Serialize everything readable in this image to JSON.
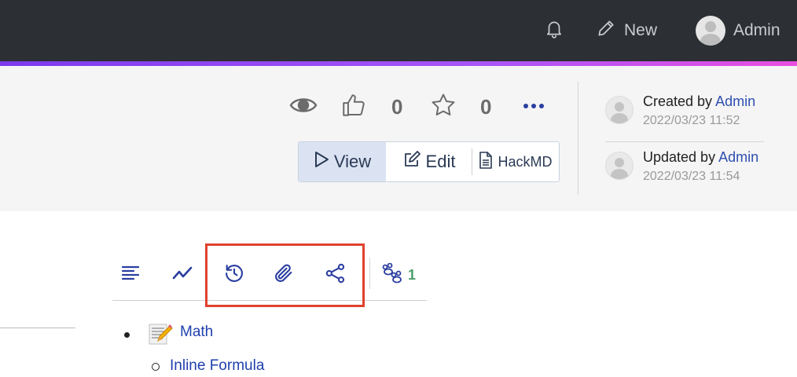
{
  "navbar": {
    "bell_icon": "bell-icon",
    "new_label": "New",
    "user_label": "Admin"
  },
  "page_header": {
    "seen_icon": "eye-icon",
    "like_count": "0",
    "star_count": "0",
    "buttons": {
      "view": "View",
      "edit": "Edit",
      "hackmd": "HackMD"
    },
    "created": {
      "prefix": "Created by",
      "user": "Admin",
      "time": "2022/03/23 11:52"
    },
    "updated": {
      "prefix": "Updated by",
      "user": "Admin",
      "time": "2022/03/23 11:54"
    }
  },
  "toolbar": {
    "tabs": [
      "list-icon",
      "trend-icon",
      "history-icon",
      "paperclip-icon",
      "share-icon"
    ],
    "footprint_count": "1"
  },
  "toc": {
    "items": [
      {
        "label": "Math",
        "children": [
          {
            "label": "Inline Formula"
          }
        ]
      }
    ]
  },
  "colors": {
    "navbar_bg": "#2c2f33",
    "accent_gradient_start": "#7c3aed",
    "accent_gradient_end": "#e84fe0",
    "link": "#1f3fae",
    "highlight_box": "#e0412e"
  }
}
